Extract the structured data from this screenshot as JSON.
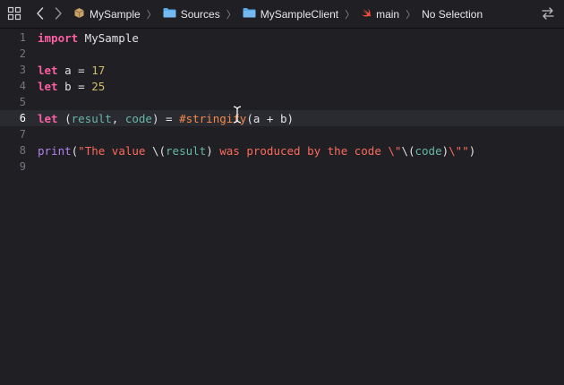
{
  "jumpbar": {
    "crumbs": [
      {
        "label": "MySample",
        "icon": "package-icon"
      },
      {
        "label": "Sources",
        "icon": "folder-icon"
      },
      {
        "label": "MySampleClient",
        "icon": "folder-icon"
      },
      {
        "label": "main",
        "icon": "swift-file-icon"
      },
      {
        "label": "No Selection",
        "icon": ""
      }
    ],
    "separator": "〉"
  },
  "editor": {
    "current_line": 6,
    "lines": [
      {
        "number": "1",
        "tokens": [
          {
            "t": "import",
            "c": "kw"
          },
          {
            "t": " MySample",
            "c": "plain"
          }
        ]
      },
      {
        "number": "2",
        "tokens": []
      },
      {
        "number": "3",
        "tokens": [
          {
            "t": "let",
            "c": "kw"
          },
          {
            "t": " a = ",
            "c": "plain"
          },
          {
            "t": "17",
            "c": "num"
          }
        ]
      },
      {
        "number": "4",
        "tokens": [
          {
            "t": "let",
            "c": "kw"
          },
          {
            "t": " b = ",
            "c": "plain"
          },
          {
            "t": "25",
            "c": "num"
          }
        ]
      },
      {
        "number": "5",
        "tokens": []
      },
      {
        "number": "6",
        "tokens": [
          {
            "t": "let",
            "c": "kw"
          },
          {
            "t": " (",
            "c": "plain"
          },
          {
            "t": "result",
            "c": "var"
          },
          {
            "t": ", ",
            "c": "plain"
          },
          {
            "t": "code",
            "c": "var"
          },
          {
            "t": ") = ",
            "c": "plain"
          },
          {
            "t": "#stringify",
            "c": "macro"
          },
          {
            "t": "(a + b)",
            "c": "plain"
          }
        ]
      },
      {
        "number": "7",
        "tokens": []
      },
      {
        "number": "8",
        "tokens": [
          {
            "t": "print",
            "c": "fn"
          },
          {
            "t": "(",
            "c": "plain"
          },
          {
            "t": "\"The value ",
            "c": "str"
          },
          {
            "t": "\\(",
            "c": "plain"
          },
          {
            "t": "result",
            "c": "var"
          },
          {
            "t": ")",
            "c": "plain"
          },
          {
            "t": " was produced by the code \\\"",
            "c": "str"
          },
          {
            "t": "\\(",
            "c": "plain"
          },
          {
            "t": "code",
            "c": "var"
          },
          {
            "t": ")",
            "c": "plain"
          },
          {
            "t": "\\\"\"",
            "c": "str"
          },
          {
            "t": ")",
            "c": "plain"
          }
        ]
      },
      {
        "number": "9",
        "tokens": []
      }
    ]
  },
  "colors": {
    "background": "#1f1f24",
    "current_line_bg": "#2a2a31",
    "keyword": "#fc5fa3",
    "number": "#d0bf69",
    "string": "#fc6a5d",
    "variable": "#67b7a4",
    "macro": "#f38a4c",
    "function": "#b281eb"
  }
}
